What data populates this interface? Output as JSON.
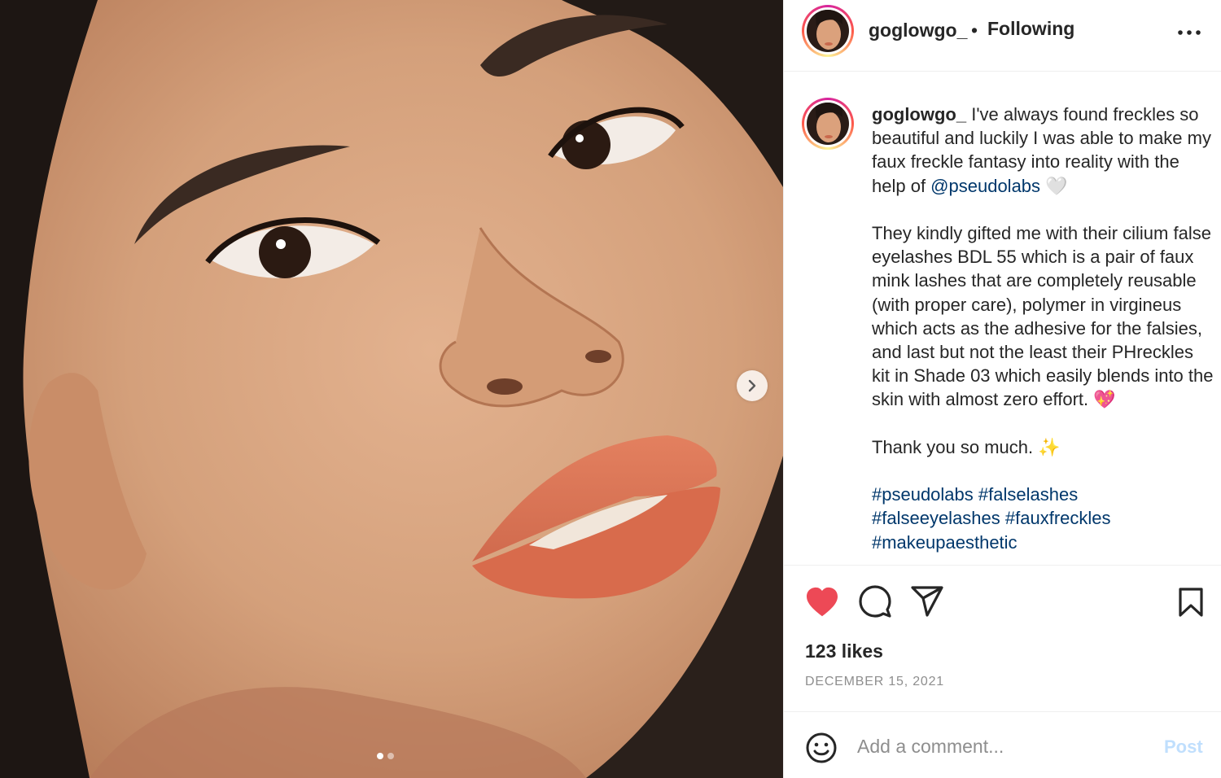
{
  "post": {
    "username": "goglowgo_",
    "separator": "•",
    "follow_status": "Following",
    "more_icon": "more-options-icon",
    "next_icon": "chevron-right-icon",
    "carousel": {
      "count": 2,
      "active_index": 0
    }
  },
  "caption": {
    "username": "goglowgo_",
    "p1_text": " I've always found freckles so beautiful and luckily I was able to make my faux freckle fantasy into reality with the help of ",
    "p1_mention": "@pseudolabs",
    "p1_emoji": " 🤍",
    "p2_text": "They kindly gifted me with their cilium false eyelashes BDL 55 which is a pair of faux mink lashes that are completely reusable (with proper care), polymer in virgineus which acts as the adhesive for the falsies, and last but not the least their PHreckles kit in Shade 03 which easily blends into the skin with almost zero effort. ",
    "p2_emoji": "💖",
    "p3_text": "Thank you so much. ",
    "p3_emoji": "✨",
    "hashtags": [
      "#pseudolabs",
      "#falselashes",
      "#falseeyelashes",
      "#fauxfreckles",
      "#makeupaesthetic"
    ]
  },
  "actions": {
    "like_icon": "heart-filled-icon",
    "comment_icon": "comment-icon",
    "share_icon": "paper-plane-icon",
    "save_icon": "bookmark-icon",
    "likes_text": "123 likes",
    "date": "DECEMBER 15, 2021"
  },
  "comment_box": {
    "emoji_icon": "smiley-icon",
    "placeholder": "Add a comment...",
    "post_label": "Post"
  },
  "colors": {
    "like": "#ed4956",
    "link": "#00376b",
    "muted": "#8e8e8e",
    "post_disabled": "#c0dffd"
  }
}
